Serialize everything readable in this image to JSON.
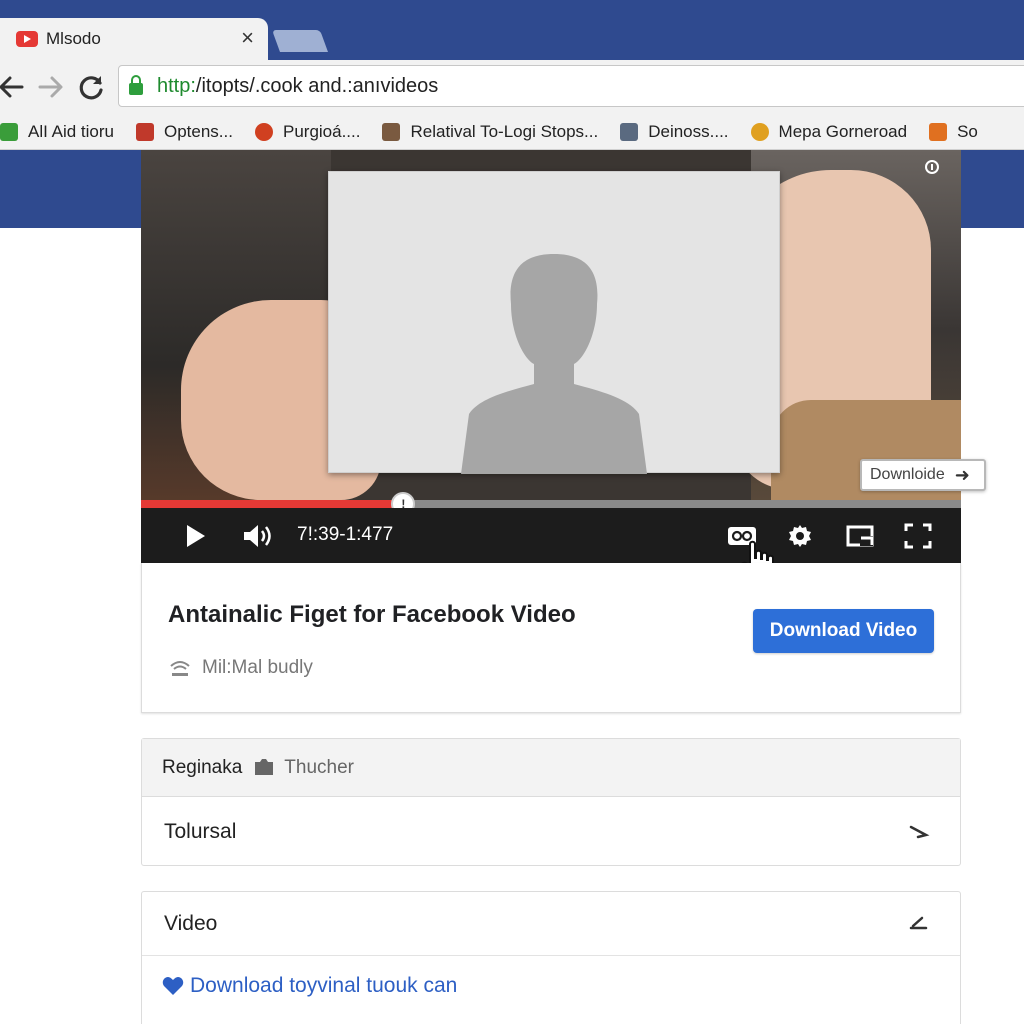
{
  "browser": {
    "tab_title": "Mlsodo",
    "tab_close": "×",
    "url_scheme": "http:",
    "url_rest": "/itopts/.cook and.:anıvideos",
    "bookmarks": [
      {
        "label": "AlI Aid tioru",
        "icon": "green-square-icon",
        "color": "#3a9d3a"
      },
      {
        "label": "Optens...",
        "icon": "red-b-icon",
        "color": "#c0392b"
      },
      {
        "label": "Purgioá....",
        "icon": "red-circle-icon",
        "color": "#d04020"
      },
      {
        "label": "Relatival To-Logi Stops...",
        "icon": "calendar-icon",
        "color": "#7a5a40"
      },
      {
        "label": "Deinoss....",
        "icon": "robot-icon",
        "color": "#5a6a80"
      },
      {
        "label": "Mepa Gorneroad",
        "icon": "chrome-icon",
        "color": "#e0a020"
      },
      {
        "label": "So",
        "icon": "download-arrow-icon",
        "color": "#e07020"
      }
    ]
  },
  "player": {
    "time": "7!:39-1:477",
    "progress": 0.32,
    "knob_label": "!",
    "download_tooltip": "Downloide"
  },
  "video_info": {
    "title": "Antainalic Figet for Facebook Video",
    "channel": "Mil:Mal budly",
    "download_button": "Download Video"
  },
  "list_panel": {
    "header_strong": "Reginaka",
    "header_sub": "Thucher",
    "row_label": "Tolursal"
  },
  "video_panel": {
    "header": "Video",
    "link": "Download toyvinal tuouk can"
  },
  "colors": {
    "brand_blue": "#2f4a8f",
    "progress_red": "#e53935",
    "button_blue": "#2d6fd8",
    "link_blue": "#2d5fc4"
  }
}
